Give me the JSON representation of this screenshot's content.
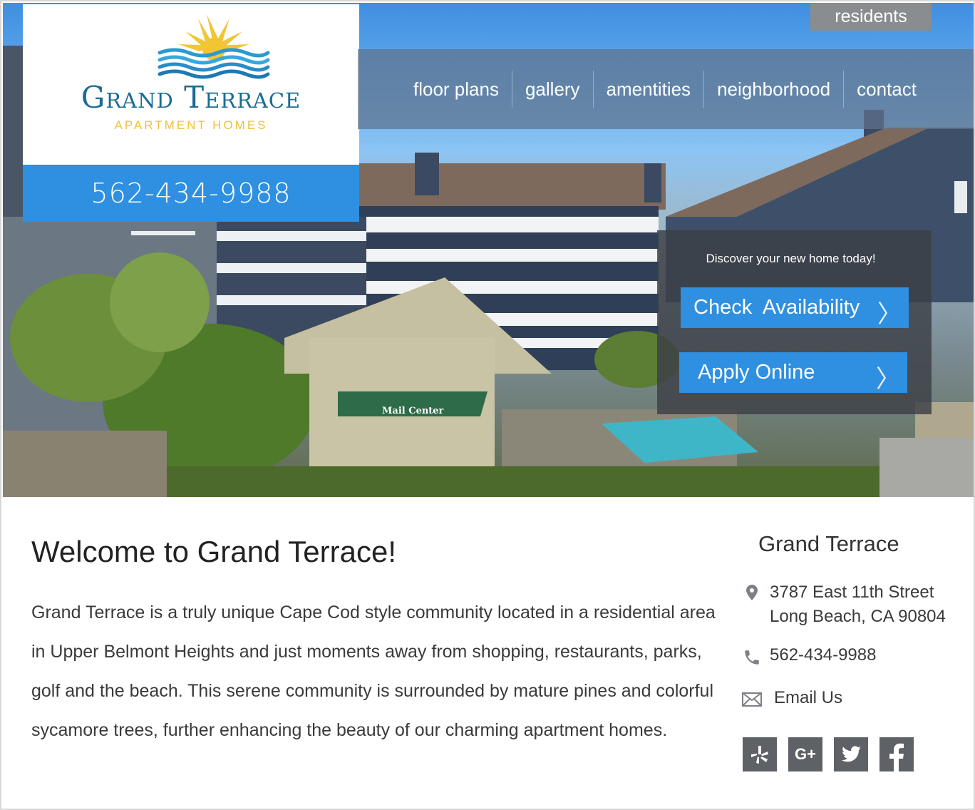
{
  "brand": {
    "title": "Grand Terrace",
    "subtitle": "APARTMENT HOMES",
    "phone": "562-434-9988",
    "colors": {
      "accent_blue": "#2f8fe0",
      "logo_blue": "#1a6c96",
      "logo_gold": "#f0c13a"
    }
  },
  "top_link": {
    "residents": "residents"
  },
  "nav": {
    "items": [
      {
        "label": "floor plans"
      },
      {
        "label": "gallery"
      },
      {
        "label": "amentities"
      },
      {
        "label": "neighborhood"
      },
      {
        "label": "contact"
      }
    ]
  },
  "hero": {
    "image_text": "Mail Center",
    "cta_text": "Discover your new home today!",
    "buttons": [
      {
        "label": "Check  Availability",
        "icon": "chevron-right-icon"
      },
      {
        "label": "Apply Online",
        "icon": "chevron-right-icon"
      }
    ]
  },
  "main": {
    "heading": "Welcome to Grand Terrace!",
    "body": "Grand Terrace is a truly unique Cape Cod style community located in a residential area in Upper Belmont Heights and just moments away from shopping, restaurants, parks, golf and the beach. This serene community is surrounded by mature pines and colorful sycamore trees, further enhancing the beauty of our charming apartment homes."
  },
  "sidebar": {
    "title": "Grand Terrace",
    "address_line1": "3787 East 11th Street",
    "address_line2": "Long Beach, CA 90804",
    "phone": "562-434-9988",
    "email_label": "Email Us",
    "social": [
      {
        "name": "yelp-icon"
      },
      {
        "name": "google-plus-icon",
        "label": "G+"
      },
      {
        "name": "twitter-icon"
      },
      {
        "name": "facebook-icon"
      }
    ]
  }
}
